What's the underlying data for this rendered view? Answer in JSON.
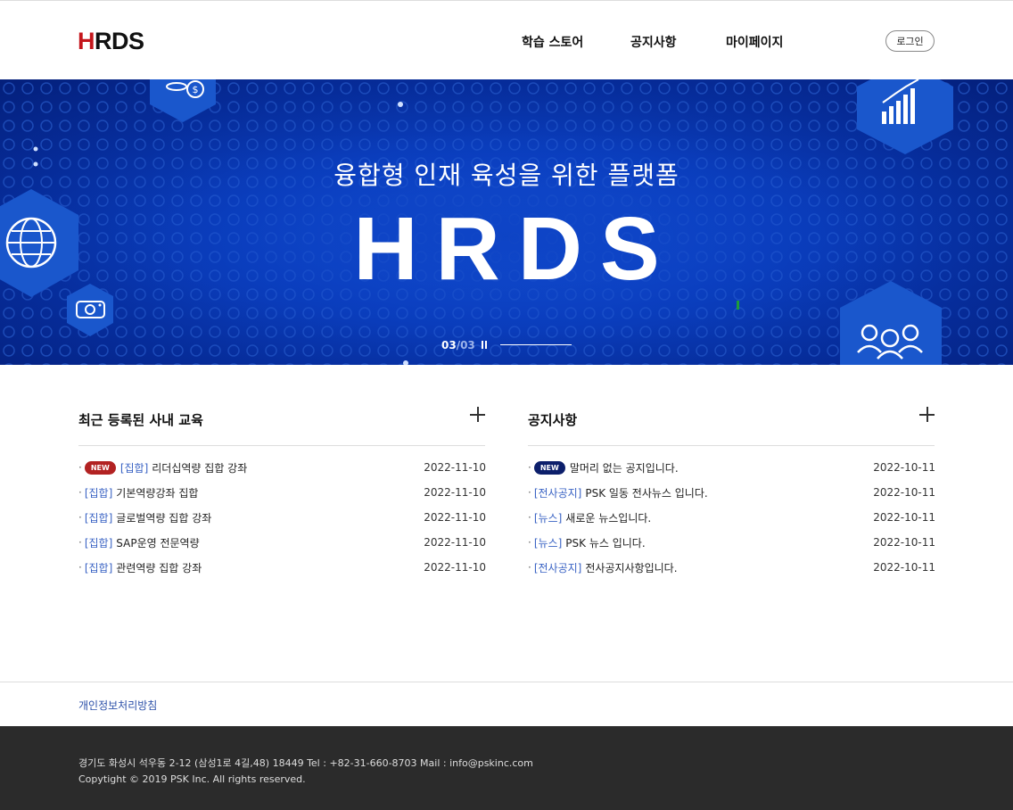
{
  "header": {
    "logo_h": "H",
    "logo_rest": "RDS",
    "nav": [
      "학습 스토어",
      "공지사항",
      "마이페이지"
    ],
    "login_label": "로그인"
  },
  "banner": {
    "subtitle": "융합형 인재 육성을 위한 플랫폼",
    "title": "HRDS",
    "slide_current": "03",
    "slide_total": "/03",
    "icons": [
      "coins-icon",
      "chart-icon",
      "globe-icon",
      "camera-icon",
      "users-icon"
    ]
  },
  "education": {
    "heading": "최근 등록된 사내 교육",
    "items": [
      {
        "badge": "NEW",
        "category": "[집합]",
        "title": "리더십역량 집합 강좌",
        "date": "2022-11-10"
      },
      {
        "badge": "",
        "category": "[집합]",
        "title": "기본역량강좌 집합",
        "date": "2022-11-10"
      },
      {
        "badge": "",
        "category": "[집합]",
        "title": "글로벌역량 집합 강좌",
        "date": "2022-11-10"
      },
      {
        "badge": "",
        "category": "[집합]",
        "title": "SAP운영 전문역량",
        "date": "2022-11-10"
      },
      {
        "badge": "",
        "category": "[집합]",
        "title": "관련역량 집합 강좌",
        "date": "2022-11-10"
      }
    ]
  },
  "notice": {
    "heading": "공지사항",
    "items": [
      {
        "badge": "NEW",
        "category": "",
        "title": "말머리 없는 공지입니다.",
        "date": "2022-10-11"
      },
      {
        "badge": "",
        "category": "[전사공지]",
        "title": "PSK 일동 전사뉴스 입니다.",
        "date": "2022-10-11"
      },
      {
        "badge": "",
        "category": "[뉴스]",
        "title": "새로운 뉴스입니다.",
        "date": "2022-10-11"
      },
      {
        "badge": "",
        "category": "[뉴스]",
        "title": "PSK 뉴스 입니다.",
        "date": "2022-10-11"
      },
      {
        "badge": "",
        "category": "[전사공지]",
        "title": "전사공지사항입니다.",
        "date": "2022-10-11"
      }
    ]
  },
  "footer": {
    "privacy": "개인정보처리방침",
    "address": "경기도 화성시 석우동 2-12 (삼성1로 4길,48) 18449   Tel : +82-31-660-8703   Mail : info@pskinc.com",
    "copyright": "Copytight © 2019 PSK Inc. All rights reserved."
  },
  "colors": {
    "logo_red": "#c4161c",
    "banner_blue": "#0b3fc0",
    "category_blue": "#3a63c4",
    "badge_red": "#b22222",
    "badge_navy": "#0c1f6b",
    "footer_dark": "#2b2b2b"
  }
}
